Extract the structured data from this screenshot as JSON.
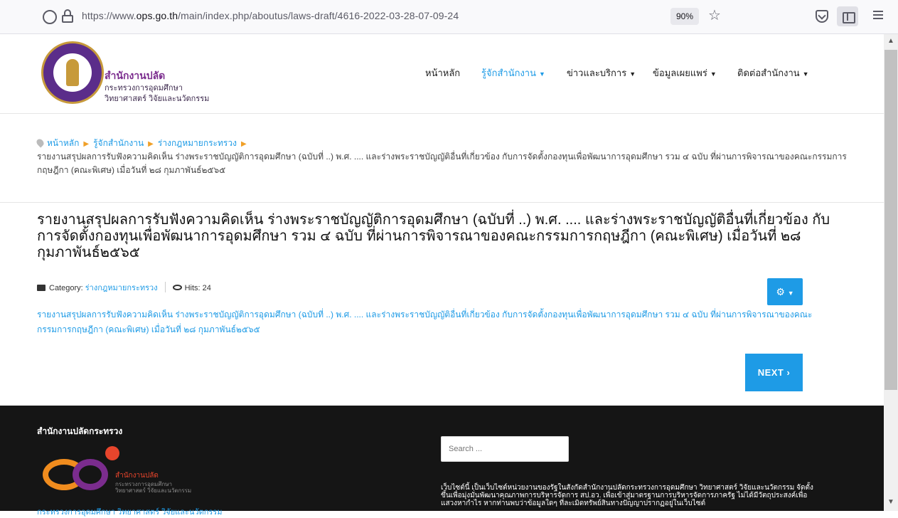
{
  "browser": {
    "url_prefix": "https://www.",
    "url_domain": "ops.go.th",
    "url_path": "/main/index.php/aboutus/laws-draft/4616-2022-03-28-07-09-24",
    "zoom": "90%"
  },
  "header": {
    "org_name": "สำนักงานปลัด",
    "org_sub1": "กระทรวงการอุดมศึกษา",
    "org_sub2": "วิทยาศาสตร์ วิจัยและนวัตกรรม"
  },
  "nav": [
    {
      "label": "หน้าหลัก",
      "has_caret": false,
      "active": false
    },
    {
      "label": "รู้จักสำนักงาน",
      "has_caret": true,
      "active": true
    },
    {
      "label": "ข่าวและบริการ",
      "has_caret": true,
      "active": false
    },
    {
      "label": "ข้อมูลเผยแพร่",
      "has_caret": true,
      "active": false
    },
    {
      "label": "ติดต่อสำนักงาน",
      "has_caret": true,
      "active": false
    }
  ],
  "breadcrumb": {
    "items": [
      "หน้าหลัก",
      "รู้จักสำนักงาน",
      "ร่างกฎหมายกระทรวง"
    ],
    "current": "รายงานสรุปผลการรับฟังความคิดเห็น ร่างพระราชบัญญัติการอุดมศึกษา (ฉบับที่ ..) พ.ศ. .... และร่างพระราชบัญญัติอื่นที่เกี่ยวข้อง กับการจัดตั้งกองทุนเพื่อพัฒนาการอุดมศึกษา รวม ๔ ฉบับ ที่ผ่านการพิจารณาของคณะกรรมการกฤษฎีกา (คณะพิเศษ) เมื่อวันที่ ๒๘ กุมภาพันธ์๒๕๖๕"
  },
  "article": {
    "title": "รายงานสรุปผลการรับฟังความคิดเห็น ร่างพระราชบัญญัติการอุดมศึกษา (ฉบับที่ ..) พ.ศ. .... และร่างพระราชบัญญัติอื่นที่เกี่ยวข้อง กับการจัดตั้งกองทุนเพื่อพัฒนาการอุดมศึกษา รวม ๔ ฉบับ ที่ผ่านการพิจารณาของคณะกรรมการกฤษฎีกา (คณะพิเศษ) เมื่อวันที่ ๒๘ กุมภาพันธ์๒๕๖๕",
    "category_label": "Category: ",
    "category_value": "ร่างกฎหมายกระทรวง",
    "hits_label": "Hits: 24",
    "body_link": "รายงานสรุปผลการรับฟังความคิดเห็น ร่างพระราชบัญญัติการอุดมศึกษา (ฉบับที่ ..) พ.ศ. .... และร่างพระราชบัญญัติอื่นที่เกี่ยวข้อง กับการจัดตั้งกองทุนเพื่อพัฒนาการอุดมศึกษา รวม ๔ ฉบับ ที่ผ่านการพิจารณาของคณะกรรมการกฤษฎีกา (คณะพิเศษ) เมื่อวันที่ ๒๘ กุมภาพันธ์๒๕๖๕",
    "next_label": "NEXT ›"
  },
  "footer": {
    "heading": "สำนักงานปลัดกระทรวง",
    "logo_name": "สำนักงานปลัด",
    "logo_sub1": "กระทรวงการอุดมศึกษา",
    "logo_sub2": "วิทยาศาสตร์ วิจัยและนวัตกรรม",
    "cut_text": "กระทรวงการอุดมศึกษา วิทยาศาสตร์ วิจัยและนวัตกรรม",
    "search_placeholder": "Search ...",
    "description": "เว็บไซต์นี้ เป็นเว็บไซต์หน่วยงานของรัฐในสังกัดสำนักงานปลัดกระทรวงการอุดมศึกษา วิทยาศาสตร์ วิจัยและนวัตกรรม จัดตั้งขึ้นเพื่อมุ่งมั่นพัฒนาคุณภาพการบริหารจัดการ สป.อว. เพื่อเข้าสู่มาตรฐานการบริหารจัดการภาครัฐ ไม่ได้มีวัตถุประสงค์เพื่อแสวงหากำไร หากท่านพบว่าข้อมูลใดๆ ที่ละเมิดทรัพย์สินทางปัญญาปรากฏอยู่ในเว็บไซต์"
  },
  "colors": {
    "accent": "#1e9be6",
    "brand_purple": "#7b2c8e",
    "footer_bg": "#151515",
    "breadcrumb_sep": "#f0a028"
  }
}
